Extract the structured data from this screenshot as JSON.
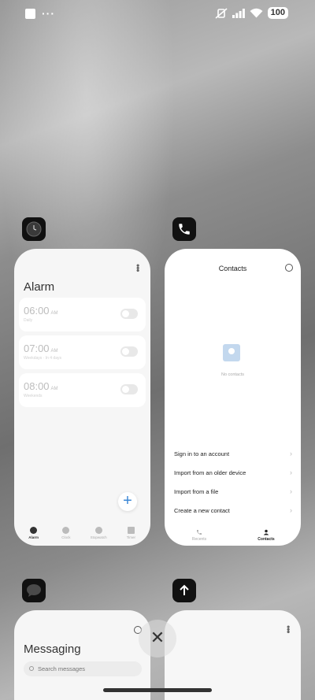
{
  "status_bar": {
    "battery": "100",
    "dots": "···"
  },
  "alarm_app": {
    "title": "Alarm",
    "alarms": [
      {
        "time": "06:00",
        "ampm": "AM",
        "sub": "Daily"
      },
      {
        "time": "07:00",
        "ampm": "AM",
        "sub": "Weekdays · In 4 days"
      },
      {
        "time": "08:00",
        "ampm": "AM",
        "sub": "Weekends"
      }
    ],
    "nav": [
      {
        "label": "Alarm",
        "active": true
      },
      {
        "label": "Clock",
        "active": false
      },
      {
        "label": "Stopwatch",
        "active": false
      },
      {
        "label": "Timer",
        "active": false
      }
    ],
    "fab": "+"
  },
  "contacts_app": {
    "title": "Contacts",
    "empty_text": "No contacts",
    "actions": [
      "Sign in to an account",
      "Import from an older device",
      "Import from a file",
      "Create a new contact"
    ],
    "nav": [
      {
        "label": "Recents",
        "active": false
      },
      {
        "label": "Contacts",
        "active": true
      }
    ]
  },
  "messaging_app": {
    "title": "Messaging",
    "search_placeholder": "Search messages"
  },
  "controls": {
    "close": "✕"
  }
}
